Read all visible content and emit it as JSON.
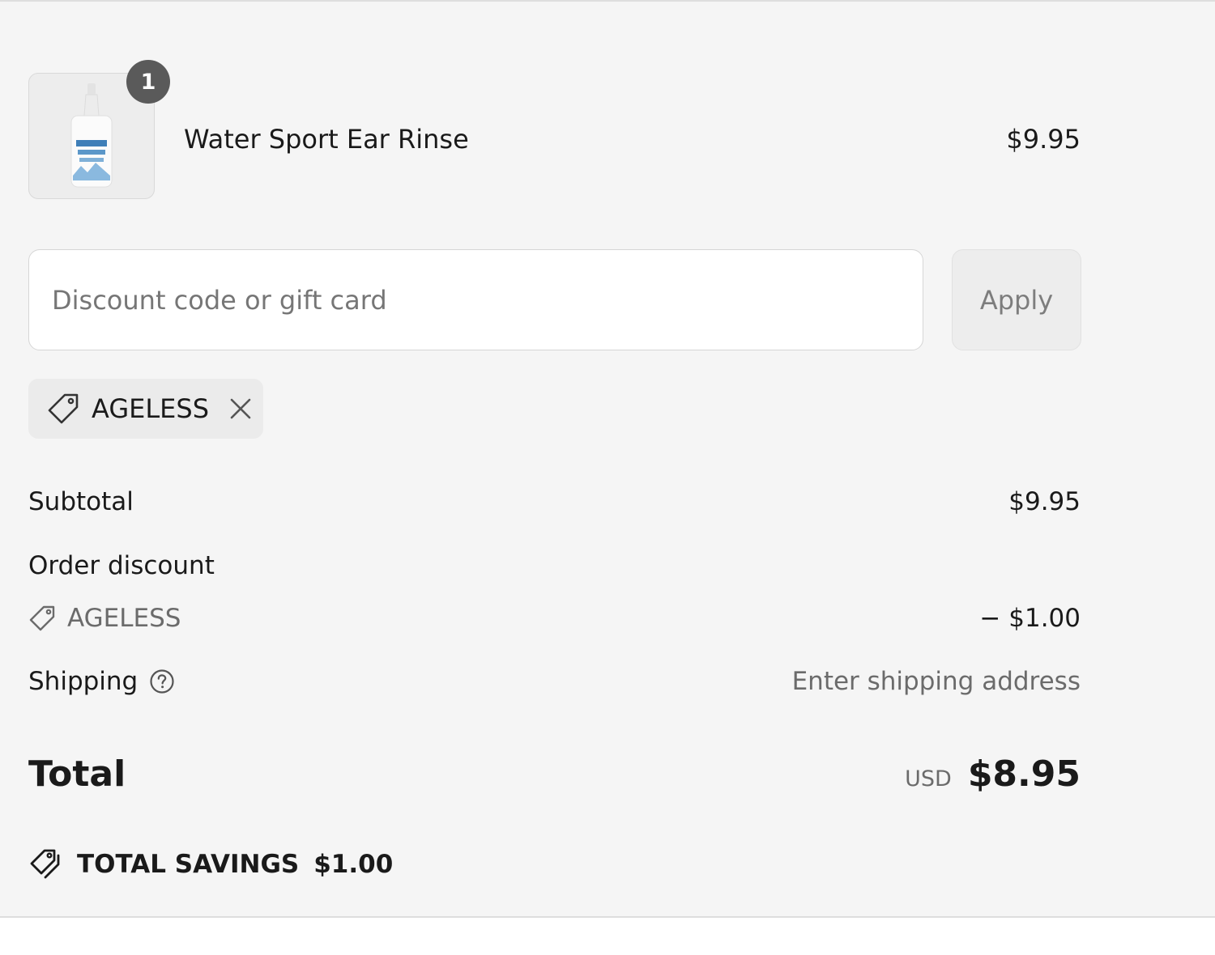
{
  "line_item": {
    "name": "Water Sport Ear Rinse",
    "price": "$9.95",
    "quantity": "1",
    "image_icon": "ear-rinse-bottle-icon"
  },
  "discount_form": {
    "placeholder": "Discount code or gift card",
    "value": "",
    "apply_label": "Apply"
  },
  "applied_code": {
    "code": "AGELESS",
    "icon": "tag-icon",
    "remove_icon": "close-icon"
  },
  "summary": {
    "subtotal_label": "Subtotal",
    "subtotal_value": "$9.95",
    "order_discount_label": "Order discount",
    "discount_code": "AGELESS",
    "discount_value": "− $1.00",
    "shipping_label": "Shipping",
    "shipping_value": "Enter shipping address",
    "shipping_help_icon": "question-circle-icon"
  },
  "total": {
    "label": "Total",
    "currency": "USD",
    "amount": "$8.95"
  },
  "savings": {
    "label": "TOTAL SAVINGS",
    "amount": "$1.00",
    "icon": "tags-icon"
  },
  "colors": {
    "panel_background": "#f5f5f5",
    "text": "#1a1a1a",
    "muted_text": "#6b6b6b",
    "badge": "#5a5a5a",
    "input_border": "#d6d6d6"
  }
}
